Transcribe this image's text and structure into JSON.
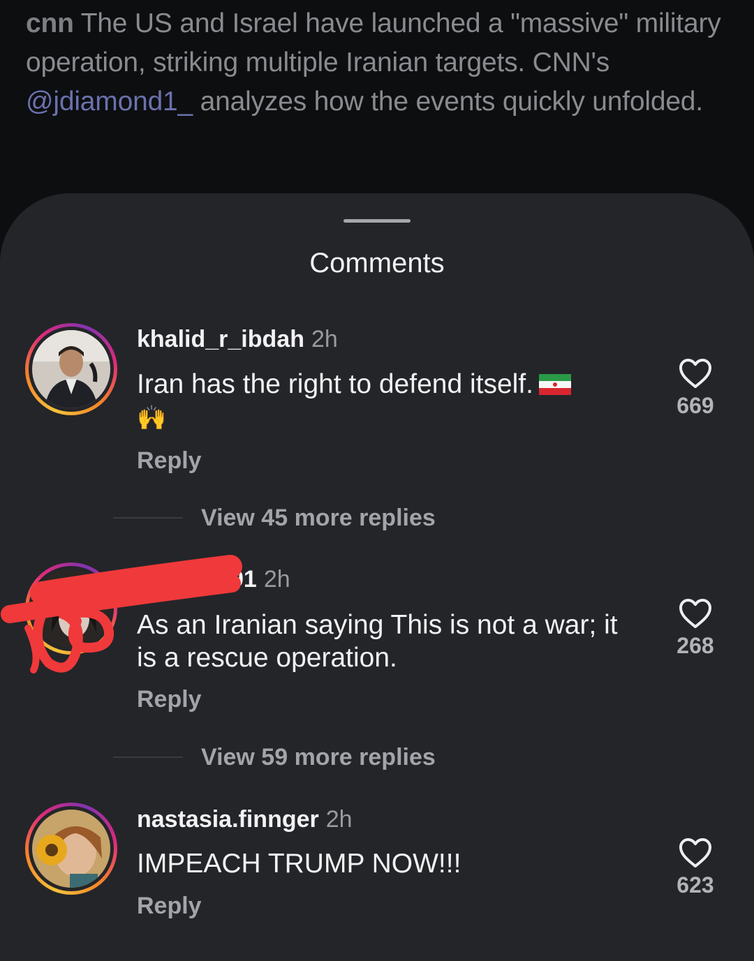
{
  "post": {
    "author": "cnn",
    "caption_before_mention": "The US and Israel have launched a \"massive\" military operation, striking multiple Iranian targets. CNN's ",
    "mention": "@jdiamond1_",
    "caption_after_mention": " analyzes how the events quickly unfolded."
  },
  "sheet": {
    "title": "Comments"
  },
  "comments": [
    {
      "username": "khalid_r_ibdah",
      "time": "2h",
      "text": "Iran has the right to defend itself.",
      "emoji_line": "🙌",
      "reply_label": "Reply",
      "likes": "669",
      "view_more": "View 45 more replies"
    },
    {
      "username": "91",
      "time": "2h",
      "text": "As an Iranian saying This is not a war; it is a rescue operation.",
      "reply_label": "Reply",
      "likes": "268",
      "view_more": "View 59 more replies"
    },
    {
      "username": "nastasia.finnger",
      "time": "2h",
      "text": "IMPEACH TRUMP NOW!!!",
      "reply_label": "Reply",
      "likes": "623"
    }
  ],
  "icons": {
    "like": "heart-outline-icon",
    "flag": "iran-flag-icon",
    "emoji": "raising-hands-emoji"
  },
  "colors": {
    "background": "#0d0e10",
    "sheet": "#242529",
    "redaction": "#f0393a",
    "mention": "#6b71ad"
  }
}
